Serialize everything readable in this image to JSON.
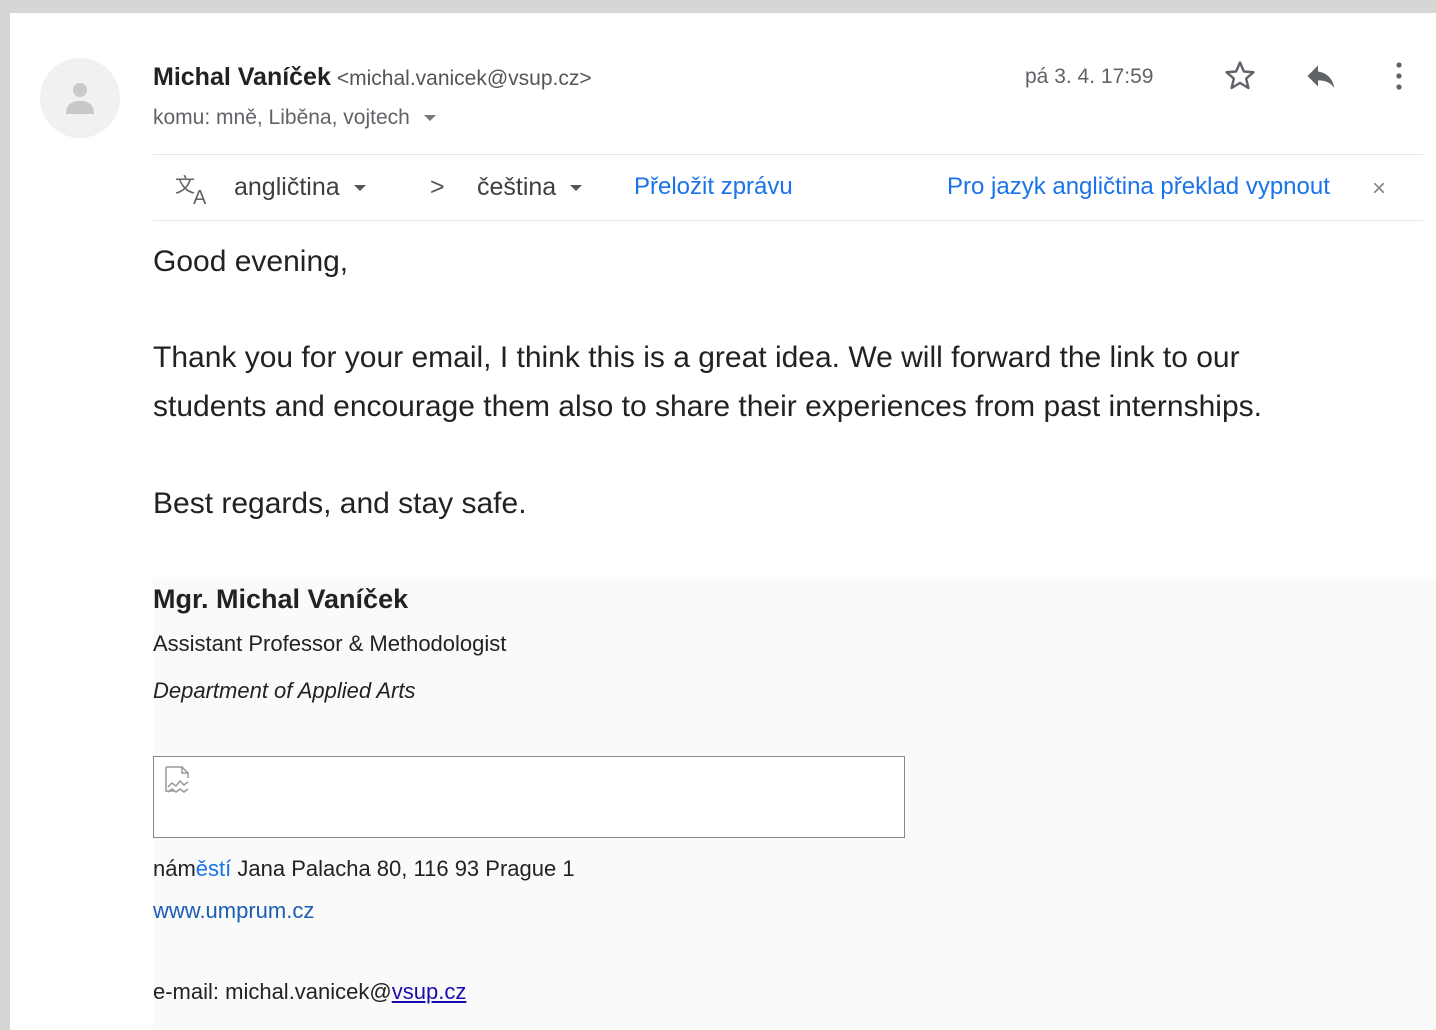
{
  "header": {
    "sender_name": "Michal Vaníček",
    "sender_email": "<michal.vanicek@vsup.cz>",
    "recipients": "komu: mně, Liběna, vojtech",
    "date": "pá 3. 4. 17:59",
    "icons": [
      "avatar-person-icon",
      "star-icon",
      "reply-icon",
      "more-vert-icon"
    ]
  },
  "translate_bar": {
    "from_lang": "angličtina",
    "to_lang": "čeština",
    "translate_label": "Přeložit zprávu",
    "turn_off_label": "Pro jazyk angličtina překlad vypnout",
    "close_glyph": "×",
    "arrow_glyph": ">"
  },
  "body": {
    "greeting": "Good evening,",
    "paragraph_line1": "Thank you for your email, I think this is a great idea. We will forward the link to our",
    "paragraph_line2": "students and encourage them also to share their experiences from past internships.",
    "closing": "Best regards, and stay safe."
  },
  "signature": {
    "name": "Mgr. Michal Vaníček",
    "title": "Assistant Professor & Methodologist",
    "department": "Department of Applied Arts",
    "address_start": "nám",
    "address_highlight": "ěstí",
    "address_rest": " Jana Palacha 80, 116 93 Prague 1",
    "website": "www.umprum.cz",
    "email_prefix": "e-mail:  michal.vanicek@",
    "email_domain": "vsup.cz"
  },
  "colors": {
    "link": "#1a73e8",
    "background": "#d6d6d6",
    "card": "#ffffff"
  }
}
